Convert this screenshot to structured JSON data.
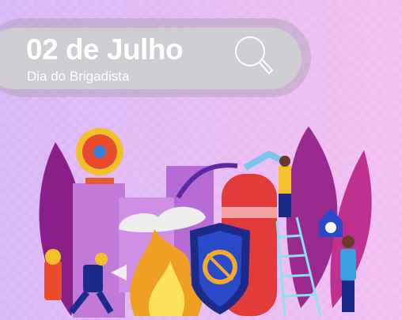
{
  "banner": {
    "title": "02 de Julho",
    "subtitle": "Dia do Brigadista",
    "search_icon": "search-icon"
  },
  "colors": {
    "background_left": "#d8b6f7",
    "background_right": "#f2bef0",
    "banner": "#cfcdd1",
    "text": "#ffffff"
  }
}
